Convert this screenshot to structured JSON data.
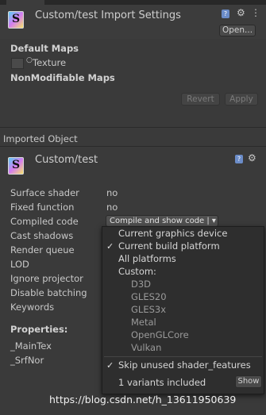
{
  "header": {
    "title": "Custom/test Import Settings",
    "open_button": "Open...",
    "default_maps": "Default Maps",
    "texture_label": "Texture",
    "nonmodifiable_maps": "NonModifiable Maps",
    "revert_button": "Revert",
    "apply_button": "Apply"
  },
  "imported": {
    "section_label": "Imported Object",
    "title": "Custom/test"
  },
  "properties": [
    {
      "label": "Surface shader",
      "value": "no"
    },
    {
      "label": "Fixed function",
      "value": "no"
    },
    {
      "label": "Compiled code",
      "value": "Compile and show code | ▾"
    },
    {
      "label": "Cast shadows",
      "value": ""
    },
    {
      "label": "Render queue",
      "value": ""
    },
    {
      "label": "LOD",
      "value": ""
    },
    {
      "label": "Ignore projector",
      "value": ""
    },
    {
      "label": "Disable batching",
      "value": ""
    },
    {
      "label": "Keywords",
      "value": ""
    }
  ],
  "props_section": {
    "title": "Properties:",
    "items": [
      "_MainTex",
      "_SrfNor"
    ]
  },
  "menu": {
    "items": [
      {
        "label": "Current graphics device",
        "checked": false
      },
      {
        "label": "Current build platform",
        "checked": true
      },
      {
        "label": "All platforms",
        "checked": false
      },
      {
        "label": "Custom:",
        "checked": false
      }
    ],
    "custom_items": [
      "D3D",
      "GLES20",
      "GLES3x",
      "Metal",
      "OpenGLCore",
      "Vulkan"
    ],
    "skip_label": "Skip unused shader_features",
    "variants_label": "1 variants included",
    "show_button": "Show"
  },
  "watermark": "https://blog.csdn.net/h_13611950639",
  "colors": {
    "background": "#3a3a3a",
    "menu_background": "#2e2e2e",
    "text": "#c8c8c8"
  }
}
